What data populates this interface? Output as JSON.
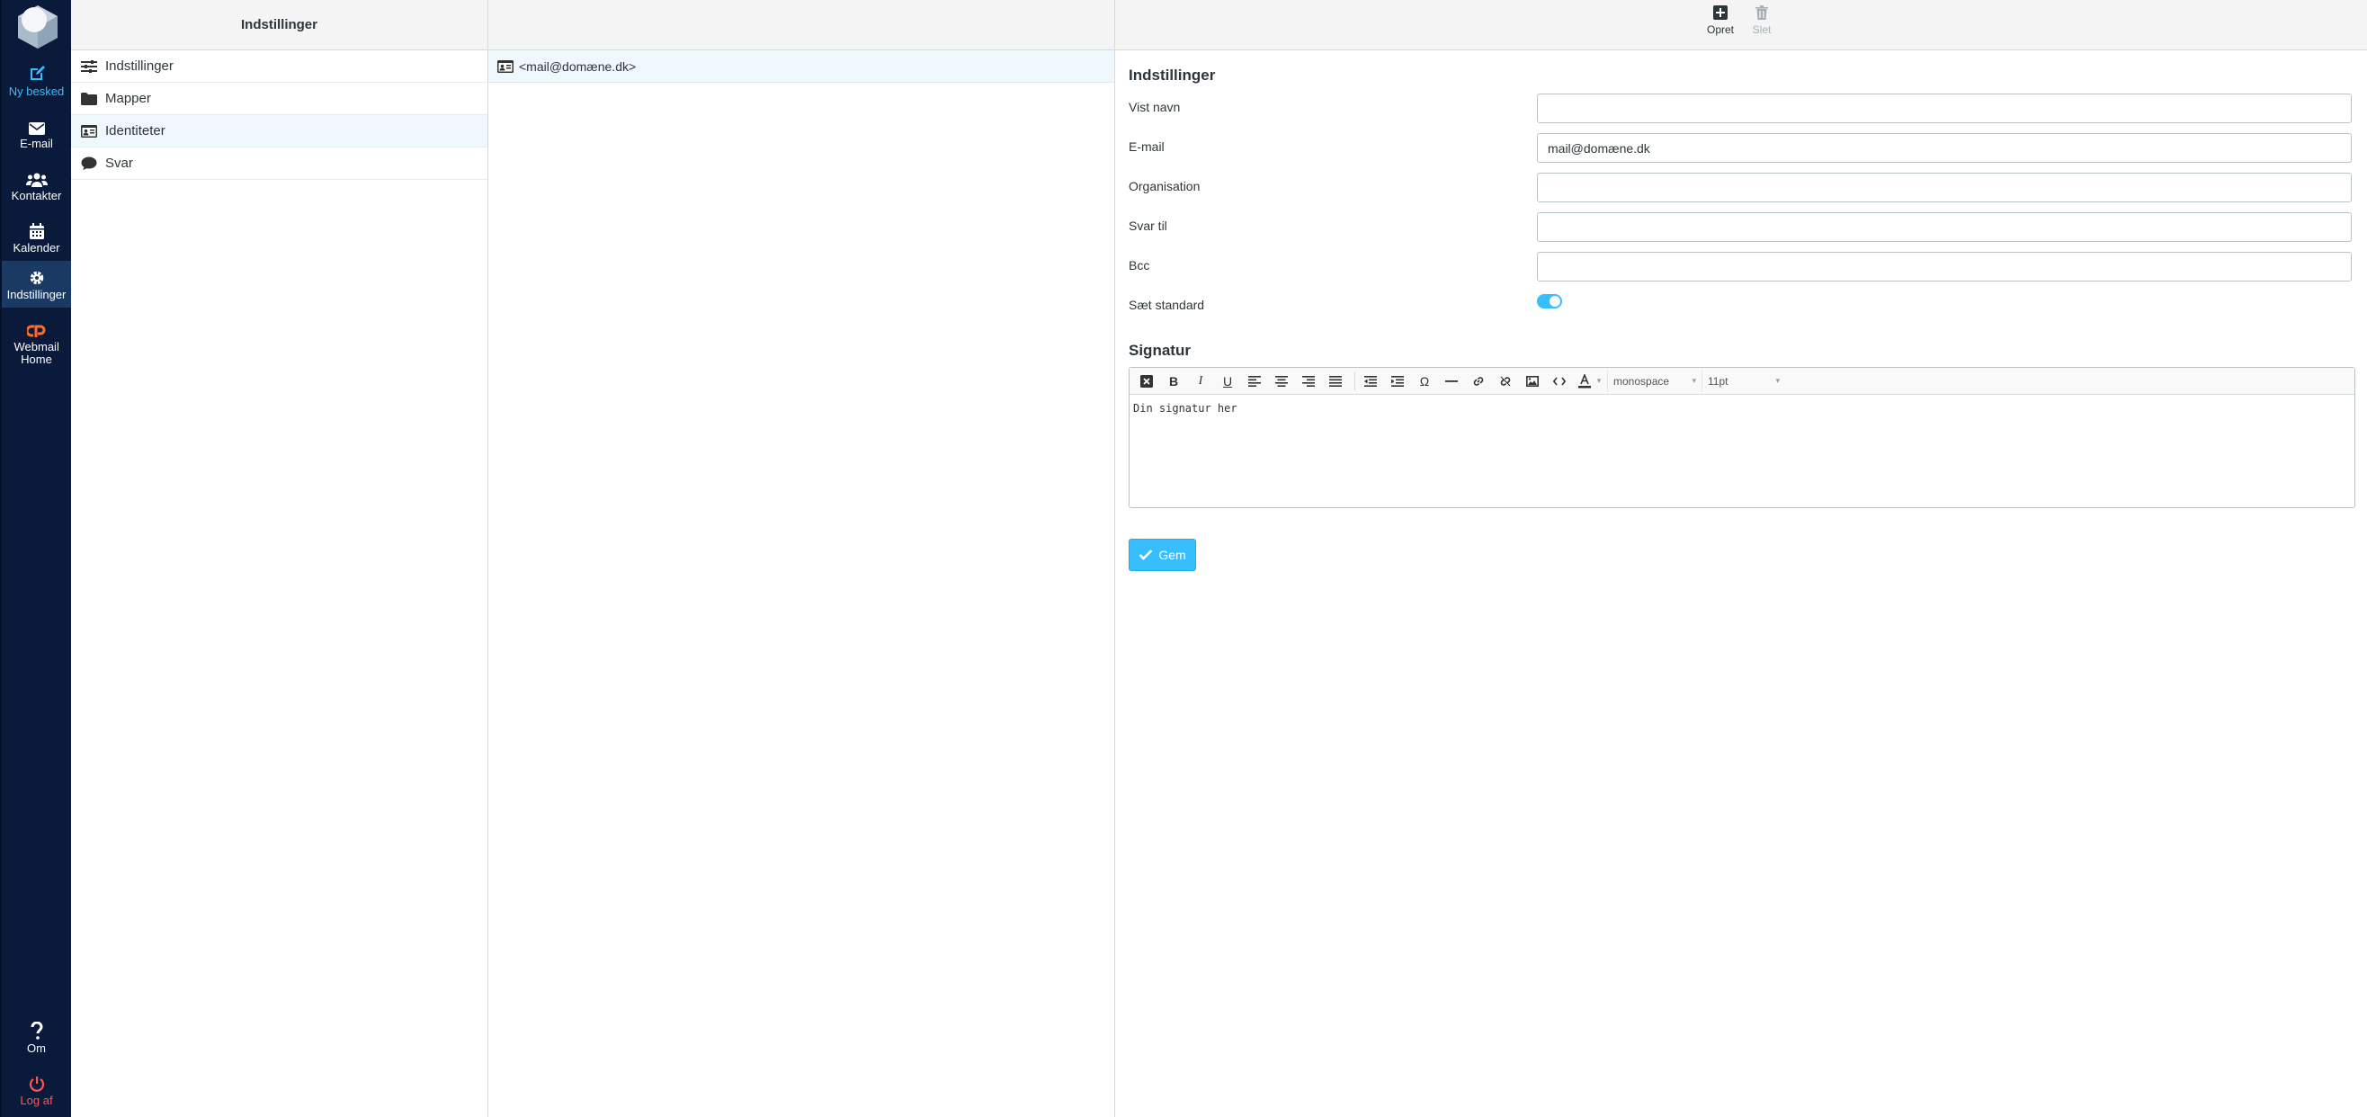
{
  "rail": {
    "items": [
      {
        "label": "Ny besked",
        "icon": "compose-icon"
      },
      {
        "label": "E-mail",
        "icon": "envelope-icon"
      },
      {
        "label": "Kontakter",
        "icon": "users-icon"
      },
      {
        "label": "Kalender",
        "icon": "calendar-icon"
      },
      {
        "label": "Indstillinger",
        "icon": "gear-icon"
      },
      {
        "label": "Webmail Home",
        "icon": "cpanel-icon"
      },
      {
        "label": "Om",
        "icon": "question-icon"
      },
      {
        "label": "Log af",
        "icon": "power-icon"
      }
    ]
  },
  "settings_panel": {
    "title": "Indstillinger",
    "items": [
      {
        "label": "Indstillinger",
        "icon": "sliders-icon"
      },
      {
        "label": "Mapper",
        "icon": "folder-icon"
      },
      {
        "label": "Identiteter",
        "icon": "id-card-icon"
      },
      {
        "label": "Svar",
        "icon": "comment-icon"
      }
    ]
  },
  "identities": {
    "items": [
      {
        "label": "<mail@domæne.dk>",
        "icon": "id-card-icon"
      }
    ]
  },
  "toolbar": {
    "create_label": "Opret",
    "delete_label": "Slet"
  },
  "form": {
    "section_title": "Indstillinger",
    "fields": {
      "name_label": "Vist navn",
      "name_value": "",
      "email_label": "E-mail",
      "email_value": "mail@domæne.dk",
      "org_label": "Organisation",
      "org_value": "",
      "reply_label": "Svar til",
      "reply_value": "",
      "bcc_label": "Bcc",
      "bcc_value": "",
      "default_label": "Sæt standard",
      "default_on": true
    },
    "signature_title": "Signatur",
    "signature_text": "Din signatur her",
    "font_family": "monospace",
    "font_size": "11pt",
    "save_label": "Gem"
  },
  "colors": {
    "rail_bg": "#0a1a3a",
    "accent": "#37beff",
    "logout": "#ff5552",
    "selected_row": "#eef8fd"
  }
}
